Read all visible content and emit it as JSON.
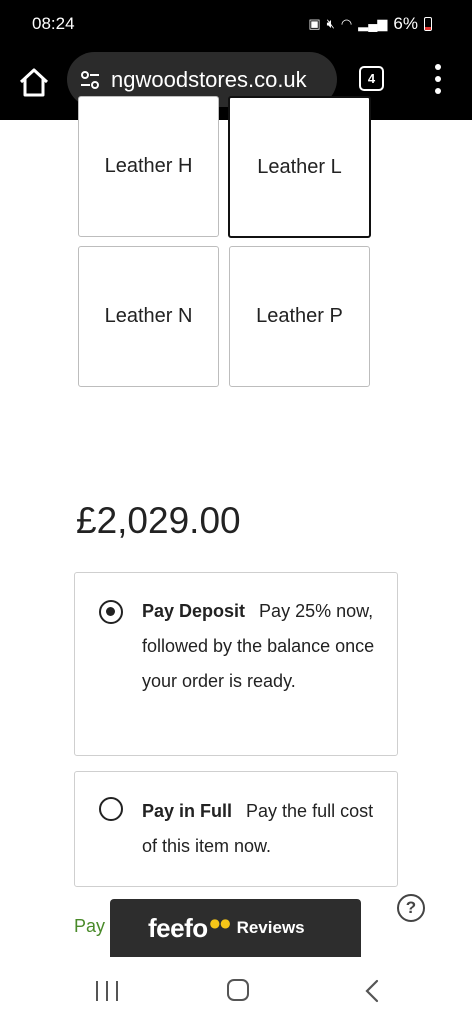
{
  "status": {
    "time": "08:24",
    "battery": "6%"
  },
  "browser": {
    "url": "ngwoodstores.co.uk",
    "tab_count": "4"
  },
  "swatches": [
    "Leather H",
    "Leather L",
    "Leather N",
    "Leather P"
  ],
  "selected_swatch": "Leather L",
  "price": "£2,029.00",
  "options": [
    {
      "title": "Pay Deposit",
      "description": "Pay 25% now, followed by the balance once your order is ready.",
      "selected": true
    },
    {
      "title": "Pay in Full",
      "description": "Pay the full cost of this item now.",
      "selected": false
    }
  ],
  "footer": {
    "pay_link": "Pay",
    "feefo_logo": "feefo",
    "feefo_label": "Reviews",
    "help": "?"
  },
  "colors": {
    "accent_green": "#4a8a2a",
    "feefo_bg": "#2d2d2d",
    "feefo_eyes": "#f5c518"
  }
}
